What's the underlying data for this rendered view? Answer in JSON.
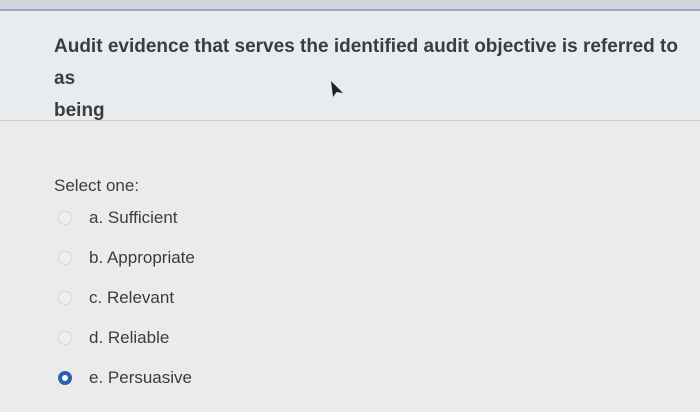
{
  "question": {
    "text": "Audit evidence that serves the identified audit objective is referred to as\nbeing"
  },
  "answers": {
    "prompt": "Select one:",
    "selected": "e",
    "options": [
      {
        "key": "a",
        "label": "a. Sufficient"
      },
      {
        "key": "b",
        "label": "b. Appropriate"
      },
      {
        "key": "c",
        "label": "c. Relevant"
      },
      {
        "key": "d",
        "label": "d. Reliable"
      },
      {
        "key": "e",
        "label": "e. Persuasive"
      }
    ]
  },
  "colors": {
    "selected_radio": "#2d5fb4",
    "text": "#3a3d40"
  },
  "icons": {
    "pointer": "mouse-cursor-icon"
  }
}
